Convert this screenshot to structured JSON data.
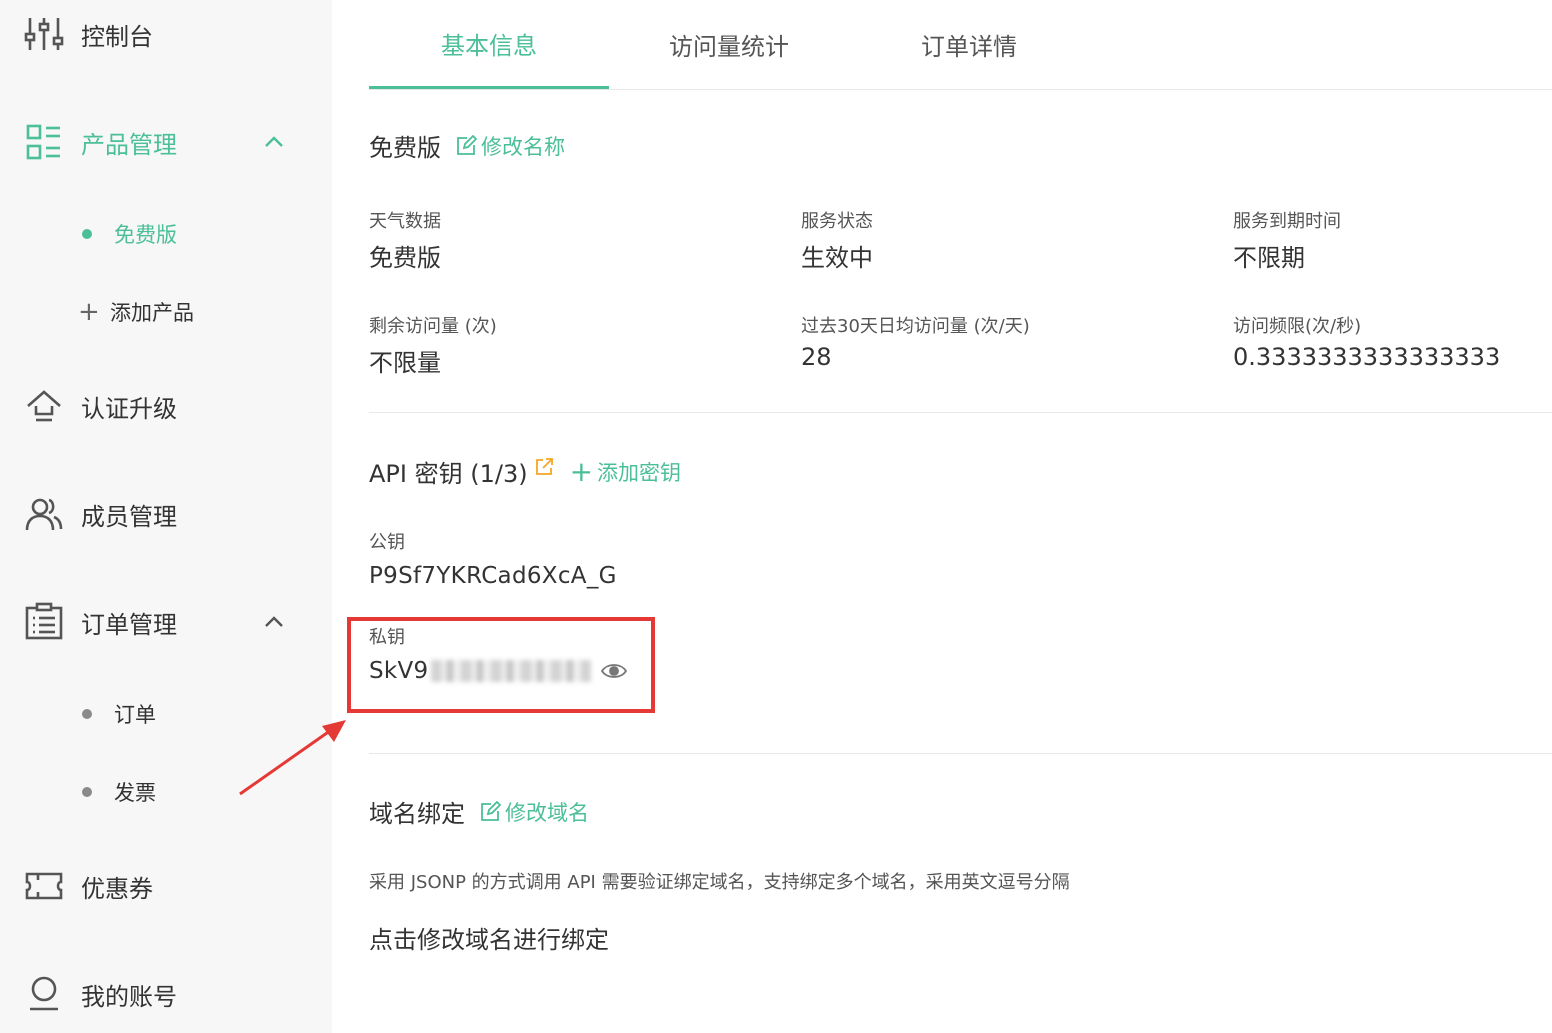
{
  "sidebar": {
    "items": [
      {
        "label": "控制台",
        "icon": "sliders-icon"
      },
      {
        "label": "产品管理",
        "icon": "product-grid-icon",
        "active": true,
        "expanded": true,
        "children": [
          {
            "label": "免费版",
            "active": true
          },
          {
            "label": "添加产品",
            "icon": "plus-icon"
          }
        ]
      },
      {
        "label": "认证升级",
        "icon": "upgrade-icon"
      },
      {
        "label": "成员管理",
        "icon": "members-icon"
      },
      {
        "label": "订单管理",
        "icon": "clipboard-icon",
        "expanded": true,
        "children": [
          {
            "label": "订单"
          },
          {
            "label": "发票"
          }
        ]
      },
      {
        "label": "优惠券",
        "icon": "coupon-icon"
      },
      {
        "label": "我的账号",
        "icon": "user-icon"
      }
    ]
  },
  "tabs": [
    {
      "label": "基本信息",
      "active": true
    },
    {
      "label": "访问量统计"
    },
    {
      "label": "订单详情"
    }
  ],
  "basic": {
    "title": "免费版",
    "rename_link": "修改名称",
    "fields": [
      {
        "label": "天气数据",
        "value": "免费版"
      },
      {
        "label": "服务状态",
        "value": "生效中"
      },
      {
        "label": "服务到期时间",
        "value": "不限期"
      },
      {
        "label": "剩余访问量 (次)",
        "value": "不限量"
      },
      {
        "label": "过去30天日均访问量 (次/天)",
        "value": "28"
      },
      {
        "label": "访问频限(次/秒)",
        "value": "0.3333333333333333"
      }
    ]
  },
  "api": {
    "title": "API 密钥 (1/3)",
    "add_link": "添加密钥",
    "public_label": "公钥",
    "public_value": "P9Sf7YKRCad6XcA_G",
    "private_label": "私钥",
    "private_value_visible": "SkV9"
  },
  "domain": {
    "title": "域名绑定",
    "edit_link": "修改域名",
    "description": "采用 JSONP 的方式调用 API 需要验证绑定域名，支持绑定多个域名，采用英文逗号分隔",
    "hint": "点击修改域名进行绑定"
  },
  "colors": {
    "accent": "#4bbf98",
    "highlight": "#e53935",
    "external_link": "#f5a623"
  }
}
